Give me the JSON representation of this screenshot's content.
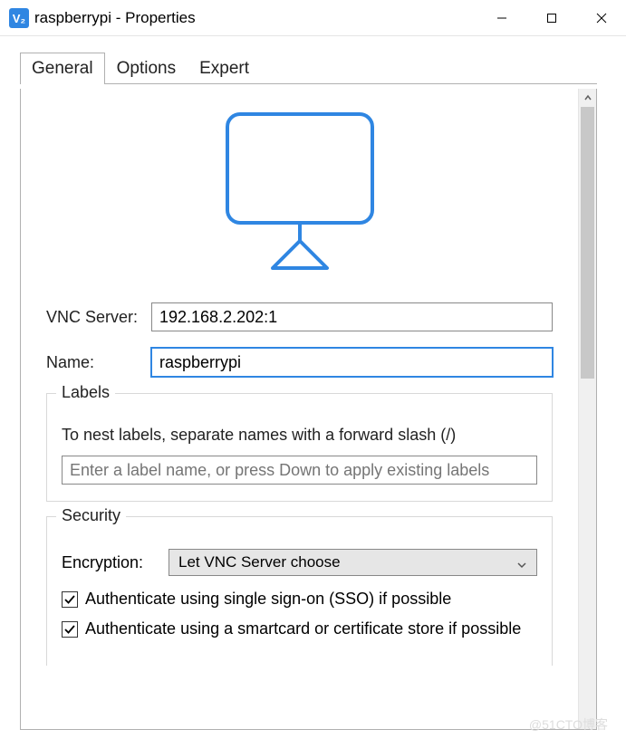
{
  "window": {
    "title": "raspberrypi - Properties"
  },
  "tabs": {
    "general": "General",
    "options": "Options",
    "expert": "Expert"
  },
  "form": {
    "vnc_server_label": "VNC Server:",
    "vnc_server_value": "192.168.2.202:1",
    "name_label": "Name:",
    "name_value": "raspberrypi"
  },
  "labels_group": {
    "legend": "Labels",
    "hint": "To nest labels, separate names with a forward slash (/)",
    "placeholder": "Enter a label name, or press Down to apply existing labels"
  },
  "security_group": {
    "legend": "Security",
    "encryption_label": "Encryption:",
    "encryption_value": "Let VNC Server choose",
    "sso_checked": true,
    "sso_label": "Authenticate using single sign-on (SSO) if possible",
    "smartcard_checked": true,
    "smartcard_label": "Authenticate using a smartcard or certificate store if possible"
  },
  "watermark": "@51CTO博客"
}
